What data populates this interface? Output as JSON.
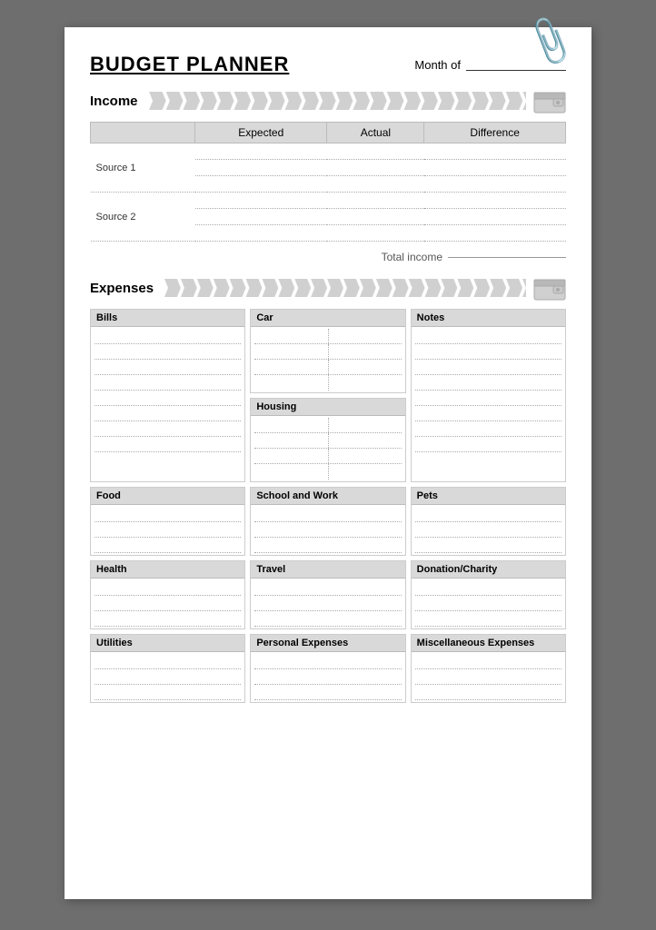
{
  "title": "BUDGET PLANNER",
  "month_of_label": "Month of",
  "income": {
    "section_label": "Income",
    "columns": [
      "Expected",
      "Actual",
      "Difference"
    ],
    "rows": [
      {
        "label": "Source 1",
        "lines": 3
      },
      {
        "label": "Source 2",
        "lines": 3
      }
    ],
    "total_label": "Total income"
  },
  "expenses": {
    "section_label": "Expenses",
    "categories": [
      {
        "id": "bills",
        "label": "Bills",
        "lines": 8
      },
      {
        "id": "car",
        "label": "Car",
        "lines": 4,
        "split": true
      },
      {
        "id": "notes",
        "label": "Notes",
        "lines": 8
      },
      {
        "id": "housing",
        "label": "Housing",
        "lines": 3
      },
      {
        "id": "food",
        "label": "Food",
        "lines": 4,
        "split": true
      },
      {
        "id": "school-work",
        "label": "School and Work",
        "lines": 3
      },
      {
        "id": "pets",
        "label": "Pets",
        "lines": 3
      },
      {
        "id": "health",
        "label": "Health",
        "lines": 3
      },
      {
        "id": "travel",
        "label": "Travel",
        "lines": 3
      },
      {
        "id": "donation-charity",
        "label": "Donation/Charity",
        "lines": 3
      },
      {
        "id": "utilities",
        "label": "Utilities",
        "lines": 3
      },
      {
        "id": "personal-expenses",
        "label": "Personal Expenses",
        "lines": 3
      },
      {
        "id": "miscellaneous-expenses",
        "label": "Miscellaneous Expenses",
        "lines": 3
      }
    ]
  }
}
